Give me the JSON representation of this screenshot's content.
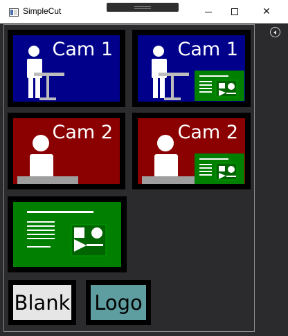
{
  "window": {
    "title": "SimpleCut",
    "minimize_label": "",
    "maximize_label": "",
    "close_label": "✕"
  },
  "sources": [
    {
      "label": "Cam 1",
      "color": "#00008b",
      "picture_in_picture": false
    },
    {
      "label": "Cam 1",
      "color": "#00008b",
      "picture_in_picture": true
    },
    {
      "label": "Cam 2",
      "color": "#8b0000",
      "picture_in_picture": false
    },
    {
      "label": "Cam 2",
      "color": "#8b0000",
      "picture_in_picture": true
    },
    {
      "label": "",
      "color": "#007f00",
      "picture_in_picture": false
    }
  ],
  "buttons": {
    "blank_label": "Blank",
    "blank_color": "#e6e6e6",
    "logo_label": "Logo",
    "logo_color": "#5f9ea0"
  },
  "colors": {
    "frame_background": "#2b2b2e",
    "tile_border": "#000000"
  }
}
